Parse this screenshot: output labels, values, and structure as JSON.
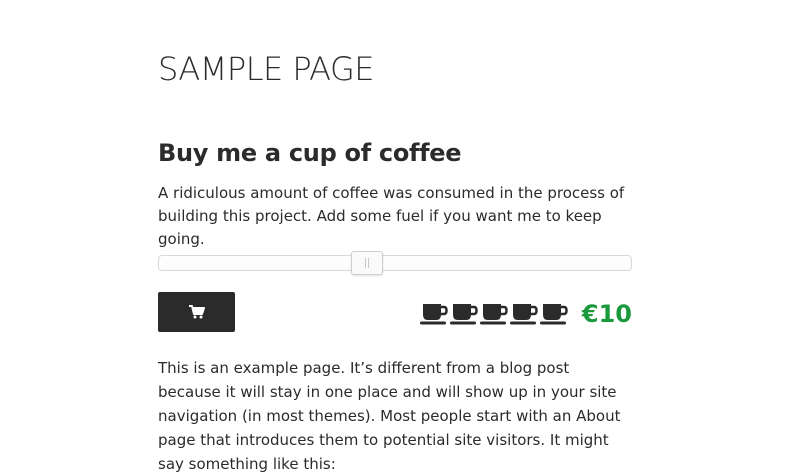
{
  "page": {
    "title": "SAMPLE PAGE"
  },
  "coffee_widget": {
    "heading": "Buy me a cup of coffee",
    "description": "A ridiculous amount of coffee was consumed in the process of building this project. Add some fuel if you want me to keep going.",
    "slider": {
      "value_fraction": 0.44
    },
    "cart_button_icon": "shopping-cart-icon",
    "cups": [
      {
        "icon": "coffee-cup-icon"
      },
      {
        "icon": "coffee-cup-icon"
      },
      {
        "icon": "coffee-cup-icon"
      },
      {
        "icon": "coffee-cup-icon"
      },
      {
        "icon": "coffee-cup-icon"
      }
    ],
    "cup_count": 5,
    "price": "€10",
    "price_color": "#1a9a3c"
  },
  "content": {
    "paragraph": "This is an example page. It’s different from a blog post because it will stay in one place and will show up in your site navigation (in most themes). Most people start with an About page that introduces them to potential site visitors. It might say something like this:"
  },
  "colors": {
    "text": "#2b2b2b",
    "button_bg": "#2b2b2b",
    "accent_green": "#1a9a3c"
  }
}
